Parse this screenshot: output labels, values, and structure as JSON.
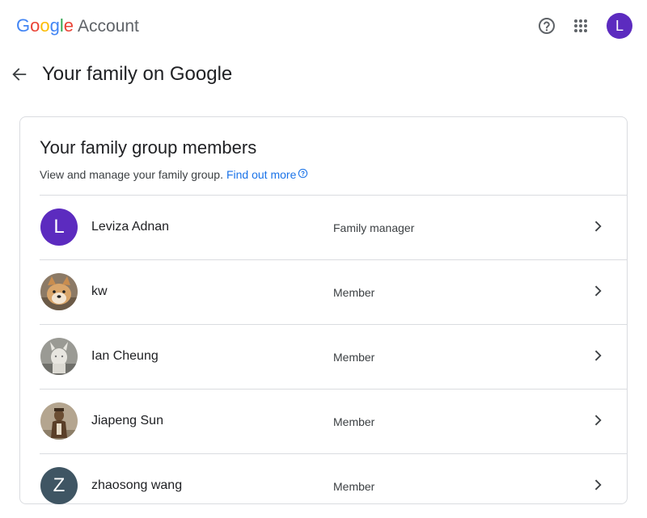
{
  "header": {
    "logo_letters": [
      {
        "char": "G",
        "color": "#4285F4"
      },
      {
        "char": "o",
        "color": "#EA4335"
      },
      {
        "char": "o",
        "color": "#FBBC05"
      },
      {
        "char": "g",
        "color": "#4285F4"
      },
      {
        "char": "l",
        "color": "#34A853"
      },
      {
        "char": "e",
        "color": "#EA4335"
      }
    ],
    "account_label": "Account",
    "help_icon": "help-circle-icon",
    "apps_icon": "apps-grid-icon",
    "avatar_letter": "L",
    "avatar_color": "#5c2bbf"
  },
  "page": {
    "back_icon": "arrow-back-icon",
    "title": "Your family on Google"
  },
  "card": {
    "title": "Your family group members",
    "description": "View and manage your family group.",
    "link_text": "Find out more",
    "link_icon": "help-circle-small-icon",
    "link_color": "#1a73e8"
  },
  "members": [
    {
      "name": "Leviza Adnan",
      "role": "Family manager",
      "avatar_type": "letter",
      "avatar_letter": "L",
      "avatar_color": "#5c2bbf"
    },
    {
      "name": "kw",
      "role": "Member",
      "avatar_type": "photo-dog"
    },
    {
      "name": "Ian Cheung",
      "role": "Member",
      "avatar_type": "photo-statue"
    },
    {
      "name": "Jiapeng Sun",
      "role": "Member",
      "avatar_type": "photo-figure"
    },
    {
      "name": "zhaosong wang",
      "role": "Member",
      "avatar_type": "letter",
      "avatar_letter": "Z",
      "avatar_color": "#3f5563"
    }
  ]
}
